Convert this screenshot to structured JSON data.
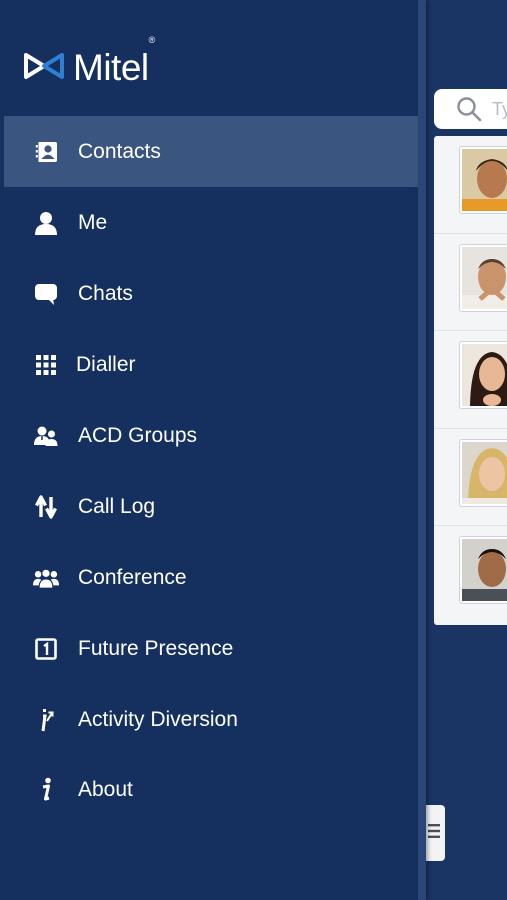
{
  "app": {
    "logo_text": "Mitel",
    "logo_mark": "®"
  },
  "menu": {
    "items": [
      {
        "label": "Contacts",
        "icon": "contacts-icon",
        "active": true
      },
      {
        "label": "Me",
        "icon": "person-icon",
        "active": false
      },
      {
        "label": "Chats",
        "icon": "chat-bubble-icon",
        "active": false
      },
      {
        "label": "Dialler",
        "icon": "keypad-icon",
        "active": false
      },
      {
        "label": "ACD Groups",
        "icon": "acd-groups-icon",
        "active": false
      },
      {
        "label": "Call Log",
        "icon": "call-log-arrows-icon",
        "active": false
      },
      {
        "label": "Conference",
        "icon": "conference-icon",
        "active": false
      },
      {
        "label": "Future Presence",
        "icon": "calendar-icon",
        "active": false
      },
      {
        "label": "Activity Diversion",
        "icon": "activity-diversion-icon",
        "active": false
      },
      {
        "label": "About",
        "icon": "info-icon",
        "active": false
      }
    ]
  },
  "contacts_panel": {
    "search_placeholder": "Ty",
    "rows": 5
  },
  "colors": {
    "background": "#15305f",
    "active_item": "#3b5581",
    "text": "#ffffff",
    "logo_accent": "#2f7fd4"
  }
}
